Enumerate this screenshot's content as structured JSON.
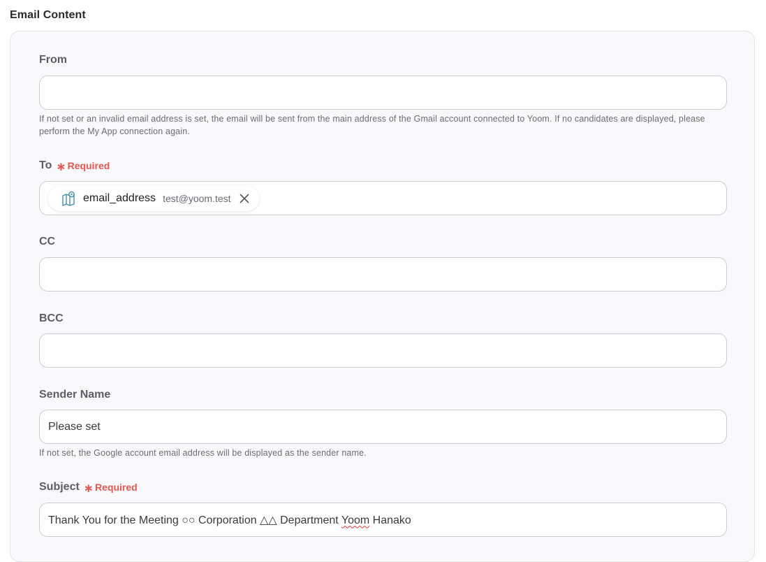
{
  "section": {
    "title": "Email Content"
  },
  "fields": {
    "from": {
      "label": "From",
      "value": "",
      "help": "If not set or an invalid email address is set, the email will be sent from the main address of the Gmail account connected to Yoom. If no candidates are displayed, please perform the My App connection again."
    },
    "to": {
      "label": "To",
      "required_label": "Required",
      "chip": {
        "name": "email_address",
        "value": "test@yoom.test",
        "icon": "map-pin-book-icon"
      }
    },
    "cc": {
      "label": "CC",
      "value": ""
    },
    "bcc": {
      "label": "BCC",
      "value": ""
    },
    "sender_name": {
      "label": "Sender Name",
      "value": "Please set",
      "help": "If not set, the Google account email address will be displayed as the sender name."
    },
    "subject": {
      "label": "Subject",
      "required_label": "Required",
      "value_before": "Thank You for the Meeting ○○ Corporation △△ Department ",
      "value_misspelled": "Yoom",
      "value_after": " Hanako"
    }
  },
  "colors": {
    "required": "#e8574f",
    "chip_icon": "#3f8fa8",
    "panel_bg": "#f9f8fb"
  }
}
